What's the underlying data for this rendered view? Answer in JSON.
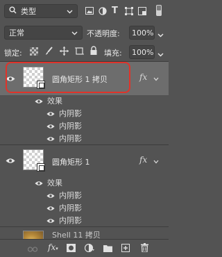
{
  "filter": {
    "kind_label": "类型"
  },
  "blend": {
    "mode": "正常",
    "opacity_label": "不透明度:",
    "opacity_value": "100%"
  },
  "lock": {
    "label": "锁定:",
    "fill_label": "填充:",
    "fill_value": "100%"
  },
  "layers": [
    {
      "name": "圆角矩形 1 拷贝",
      "effects_label": "效果",
      "effects": [
        "内阴影",
        "内阴影",
        "内阴影"
      ]
    },
    {
      "name": "圆角矩形 1",
      "effects_label": "效果",
      "effects": [
        "内阴影",
        "内阴影",
        "内阴影"
      ]
    },
    {
      "name": "Shell 11 拷贝"
    }
  ],
  "colors": {
    "highlight_outline": "#e0332a",
    "selected_bg": "#6d6d6d",
    "panel_bg": "#535353"
  },
  "icons": [
    "search-icon",
    "chevron-down-icon",
    "image-filter-icon",
    "circle-filter-icon",
    "type-filter-icon",
    "transform-filter-icon",
    "smart-object-filter-icon",
    "toggle-filter-icon",
    "lock-transparent-icon",
    "lock-paint-icon",
    "lock-move-icon",
    "lock-artboard-icon",
    "lock-all-icon",
    "eye-icon",
    "link-icon",
    "fx-icon",
    "mask-icon",
    "adjustment-icon",
    "folder-icon",
    "new-layer-icon",
    "trash-icon"
  ]
}
